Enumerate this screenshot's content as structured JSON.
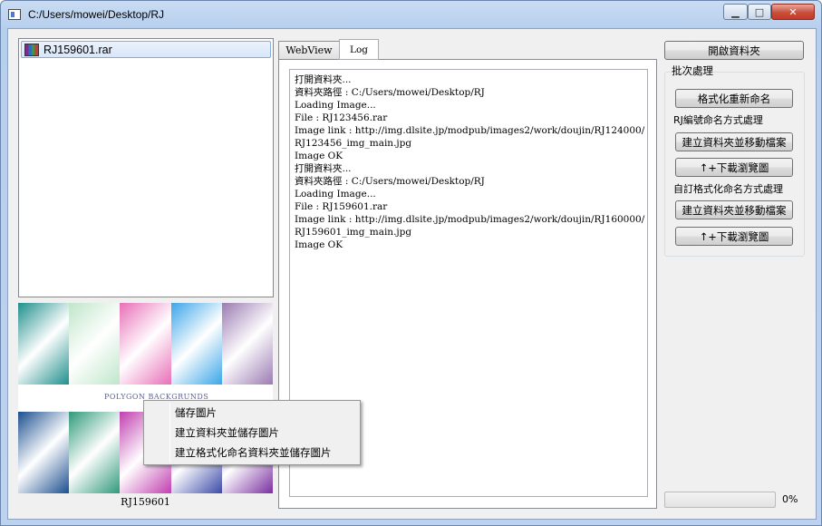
{
  "window": {
    "title": "C:/Users/mowei/Desktop/RJ",
    "min_glyph": "▁",
    "max_glyph": "□",
    "close_glyph": "✕"
  },
  "file_list": {
    "items": [
      {
        "name": "RJ159601.rar",
        "icon": "rar-archive-icon"
      }
    ]
  },
  "preview": {
    "caption": "POLYGON BACKGRUNDS",
    "name": "RJ159601",
    "colors_top": [
      "#1e8f8c",
      "#bfe6c9",
      "#e86fb7",
      "#3aa6e8",
      "#9b7bb2"
    ],
    "colors_bottom": [
      "#1b4f8f",
      "#2f9a7a",
      "#c13fb0",
      "#3c4ba8",
      "#7a2fa0"
    ]
  },
  "tabs": [
    {
      "label": "WebView"
    },
    {
      "label": "Log"
    }
  ],
  "log": {
    "lines": [
      "打開資料夾...",
      "資料夾路徑 : C:/Users/mowei/Desktop/RJ",
      "Loading Image...",
      "File : RJ123456.rar",
      "Image link : http://img.dlsite.jp/modpub/images2/work/doujin/RJ124000/",
      "RJ123456_img_main.jpg",
      "Image OK",
      "打開資料夾...",
      "資料夾路徑 : C:/Users/mowei/Desktop/RJ",
      "Loading Image...",
      "File : RJ159601.rar",
      "Image link : http://img.dlsite.jp/modpub/images2/work/doujin/RJ160000/",
      "RJ159601_img_main.jpg",
      "Image OK"
    ]
  },
  "right_panel": {
    "open_folder": "開啟資料夾",
    "batch_label": "批次處理",
    "format_rename": "格式化重新命名",
    "rj_label": "RJ編號命名方式處理",
    "create_move_1": "建立資料夾並移動檔案",
    "download_1": "↑+下載瀏覽圖",
    "custom_label": "自訂格式化命名方式處理",
    "create_move_2": "建立資料夾並移動檔案",
    "download_2": "↑+下載瀏覽圖"
  },
  "progress": {
    "value": 0,
    "label": "0%"
  },
  "context_menu": {
    "items": [
      "儲存圖片",
      "建立資料夾並儲存圖片",
      "建立格式化命名資料夾並儲存圖片"
    ]
  }
}
